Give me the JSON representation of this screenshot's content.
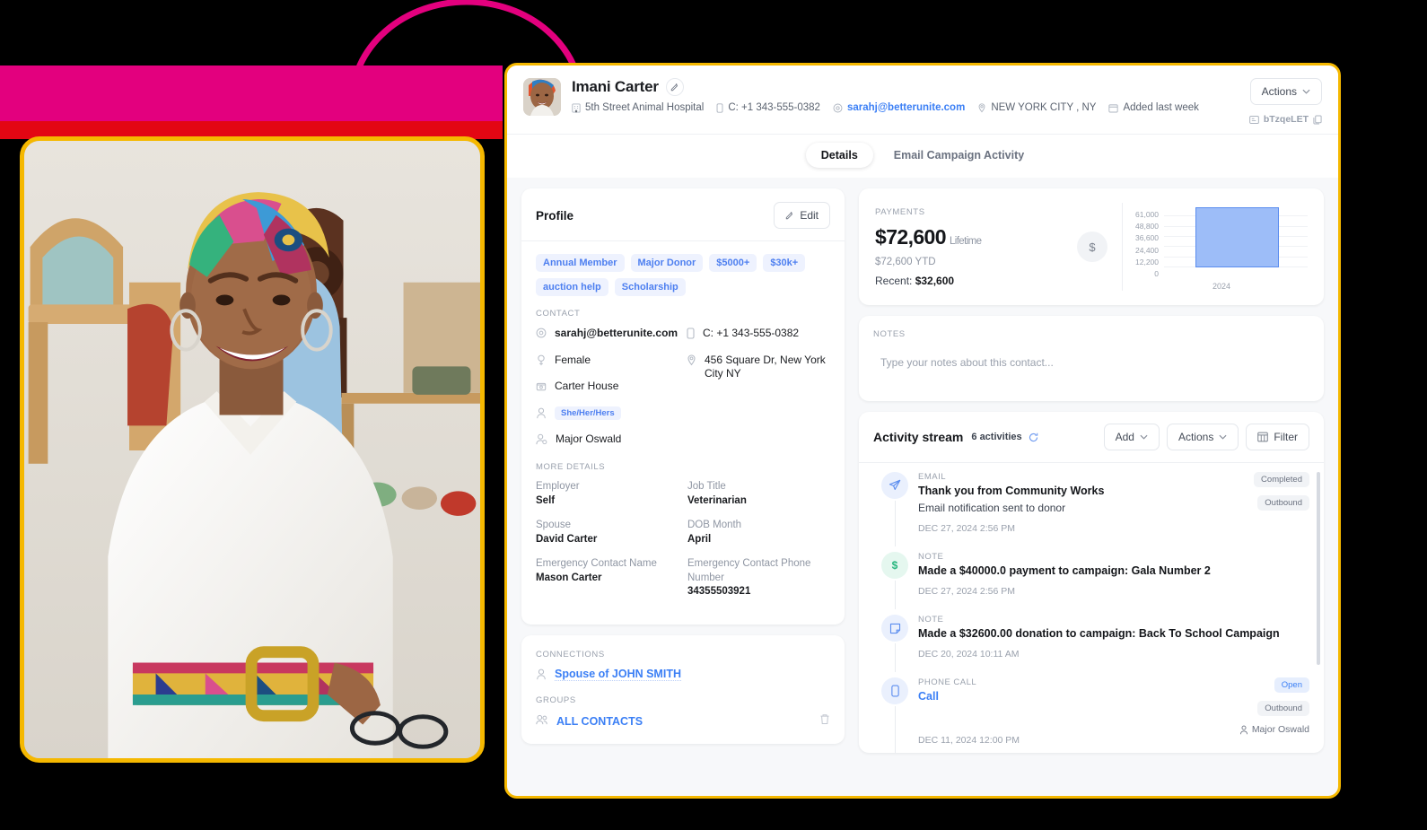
{
  "decor": {
    "band_magenta_color": "#e3007e",
    "band_red_color": "#e30613",
    "arc_color": "#e3007e",
    "card_border_color": "#f5b800"
  },
  "header": {
    "contact_name": "Imani Carter",
    "edit_icon": "pencil-icon",
    "avatar_name": "contact-avatar",
    "meta": [
      {
        "icon": "building-icon",
        "text": "5th Street Animal Hospital",
        "link": false
      },
      {
        "icon": "mobile-icon",
        "text": "C: +1 343-555-0382",
        "link": false
      },
      {
        "icon": "at-icon",
        "text": "sarahj@betterunite.com",
        "link": true
      },
      {
        "icon": "location-pin-icon",
        "text": "NEW YORK CITY , NY",
        "link": false
      },
      {
        "icon": "calendar-icon",
        "text": "Added last week",
        "link": false
      }
    ],
    "actions_label": "Actions",
    "record_id": "bTzqeLET",
    "copy_icon": "copy-icon"
  },
  "tabs": [
    {
      "label": "Details",
      "active": true
    },
    {
      "label": "Email Campaign Activity",
      "active": false
    }
  ],
  "profile": {
    "title": "Profile",
    "edit_label": "Edit",
    "tags": [
      "Annual Member",
      "Major Donor",
      "$5000+",
      "$30k+",
      "auction help",
      "Scholarship"
    ],
    "contact_label": "CONTACT",
    "contact_left": [
      {
        "icon": "at-icon",
        "value": "sarahj@betterunite.com",
        "link": true
      },
      {
        "icon": "gender-icon",
        "value": "Female",
        "link": false
      },
      {
        "icon": "household-icon",
        "value": "Carter House",
        "link": false
      },
      {
        "icon": "person-icon",
        "value": "She/Her/Hers",
        "pill": true
      },
      {
        "icon": "person-gear-icon",
        "value": "Major Oswald",
        "link": false
      }
    ],
    "contact_right": [
      {
        "icon": "mobile-icon",
        "value": "C: +1 343-555-0382"
      },
      {
        "icon": "location-pin-icon",
        "value": "456 Square Dr, New York City NY"
      }
    ],
    "more_details_label": "MORE DETAILS",
    "details_left": [
      {
        "label": "Employer",
        "value": "Self"
      },
      {
        "label": "Spouse",
        "value": "David Carter"
      },
      {
        "label": "Emergency Contact Name",
        "value": "Mason Carter"
      }
    ],
    "details_right": [
      {
        "label": "Job Title",
        "value": "Veterinarian"
      },
      {
        "label": "DOB Month",
        "value": "April"
      },
      {
        "label": "Emergency Contact Phone Number",
        "value": "34355503921"
      }
    ]
  },
  "connections": {
    "connections_label": "CONNECTIONS",
    "connection_text": "Spouse of JOHN SMITH",
    "groups_label": "GROUPS",
    "group_name": "ALL CONTACTS",
    "delete_icon": "trash-icon"
  },
  "payments": {
    "label": "PAYMENTS",
    "amount": "$72,600",
    "amount_suffix": "Lifetime",
    "ytd": "$72,600 YTD",
    "recent_label": "Recent:",
    "recent_value": "$32,600",
    "dollar_icon": "dollar-icon"
  },
  "chart_data": {
    "type": "bar",
    "title": "",
    "categories": [
      "2024"
    ],
    "values": [
      72600
    ],
    "ytick_labels": [
      "61,000",
      "48,800",
      "36,600",
      "24,400",
      "12,200",
      "0"
    ],
    "ytick_values": [
      61000,
      48800,
      36600,
      24400,
      12200,
      0
    ],
    "ylim": [
      0,
      73200
    ],
    "xlabel": "",
    "ylabel": "",
    "grid": true,
    "legend": "none",
    "bar_fill": "#9dbdf8",
    "bar_stroke": "#5b8def"
  },
  "notes": {
    "label": "NOTES",
    "placeholder": "Type your notes about this contact..."
  },
  "activity": {
    "title": "Activity stream",
    "count_label": "6 activities",
    "refresh_icon": "refresh-icon",
    "add_label": "Add",
    "actions_label": "Actions",
    "filter_label": "Filter",
    "filter_icon": "table-icon",
    "items": [
      {
        "icon": "paper-plane-icon",
        "icon_color": "blue",
        "kind": "EMAIL",
        "subject": "Thank you from Community Works",
        "subject_link": false,
        "description": "Email notification sent to donor",
        "date": "DEC 27, 2024 2:56 PM",
        "badges": [
          {
            "text": "Completed",
            "style": "grey"
          },
          {
            "text": "Outbound",
            "style": "grey"
          }
        ],
        "owner": ""
      },
      {
        "icon": "dollar-icon",
        "icon_color": "green",
        "kind": "NOTE",
        "subject": "Made a $40000.0 payment to campaign: Gala Number 2",
        "subject_link": false,
        "description": "",
        "date": "DEC 27, 2024 2:56 PM",
        "badges": [],
        "owner": ""
      },
      {
        "icon": "note-icon",
        "icon_color": "blue",
        "kind": "NOTE",
        "subject": "Made a $32600.00 donation to campaign: Back To School Campaign",
        "subject_link": false,
        "description": "",
        "date": "DEC 20, 2024 10:11 AM",
        "badges": [],
        "owner": ""
      },
      {
        "icon": "mobile-icon",
        "icon_color": "blue",
        "kind": "PHONE CALL",
        "subject": "Call",
        "subject_link": true,
        "description": "",
        "date": "DEC 11, 2024 12:00 PM",
        "badges": [
          {
            "text": "Open",
            "style": "blue"
          },
          {
            "text": "Outbound",
            "style": "grey"
          }
        ],
        "owner": "Major Oswald"
      }
    ]
  }
}
